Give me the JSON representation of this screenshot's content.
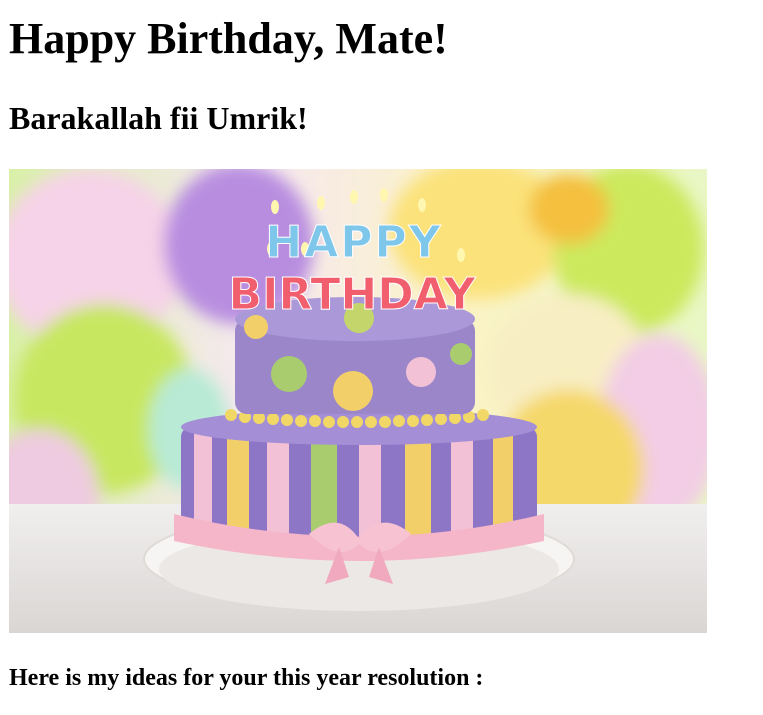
{
  "heading": "Happy Birthday, Mate!",
  "subheading": "Barakallah fii Umrik!",
  "footer_text": "Here is my ideas for your this year resolution :",
  "image": {
    "candle_line1": "HAPPY",
    "candle_line2": "BIRTHDAY"
  },
  "colors": {
    "text": "#000000",
    "background": "#ffffff",
    "cake_top": "#9a86c9",
    "cake_bottom": "#8a74c4",
    "ribbon": "#f4b6c8"
  }
}
